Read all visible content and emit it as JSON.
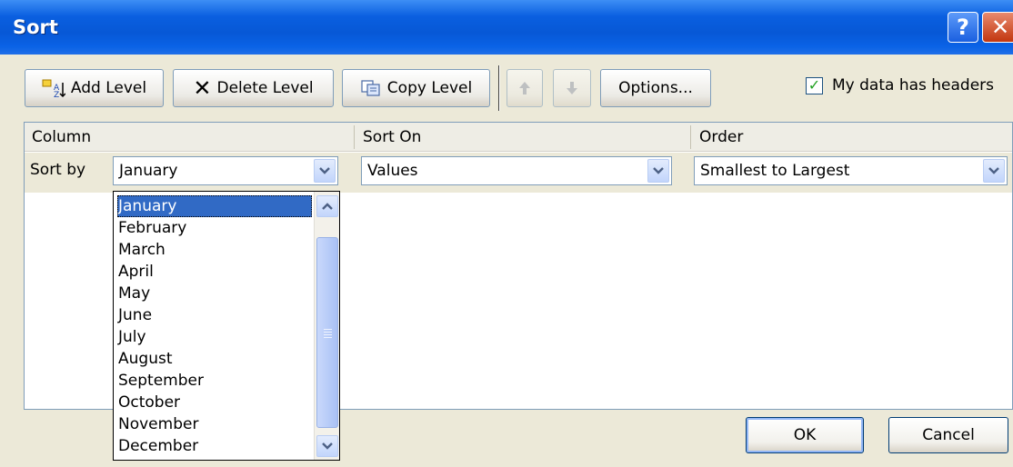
{
  "window": {
    "title": "Sort"
  },
  "toolbar": {
    "add_level": "Add Level",
    "delete_level": "Delete Level",
    "copy_level": "Copy Level",
    "options": "Options...",
    "headers_label": "My data has headers",
    "headers_checked": true
  },
  "grid": {
    "columns": {
      "column": "Column",
      "sort_on": "Sort On",
      "order": "Order"
    },
    "rows": [
      {
        "label": "Sort by",
        "column": "January",
        "sort_on": "Values",
        "order": "Smallest to Largest"
      }
    ]
  },
  "dropdown": {
    "items": [
      "January",
      "February",
      "March",
      "April",
      "May",
      "June",
      "July",
      "August",
      "September",
      "October",
      "November",
      "December"
    ],
    "selected": "January"
  },
  "buttons": {
    "ok": "OK",
    "cancel": "Cancel"
  },
  "colors": {
    "titlebar": "#0a5fe0",
    "dialog_bg": "#ece9d8",
    "selection": "#316ac5"
  }
}
